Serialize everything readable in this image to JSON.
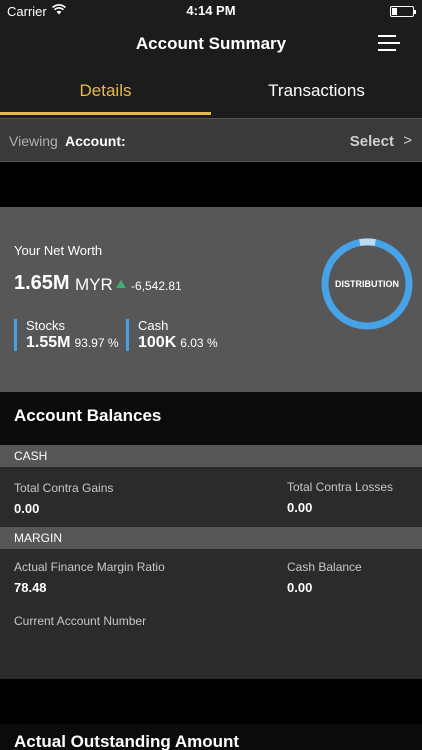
{
  "status_bar": {
    "carrier": "Carrier",
    "time": "4:14 PM"
  },
  "nav": {
    "title": "Account Summary",
    "menu_icon": "hamburger-menu-icon"
  },
  "tabs": [
    {
      "label": "Details",
      "active": true
    },
    {
      "label": "Transactions",
      "active": false
    }
  ],
  "viewing": {
    "label": "Viewing",
    "account_label": "Account:",
    "select_label": "Select",
    "chevron": ">"
  },
  "net_worth": {
    "label": "Your Net Worth",
    "value": "1.65M",
    "unit": "MYR",
    "change": "-6,542.81",
    "trend_icon": "up-arrow-icon",
    "distribution_label": "DISTRIBUTION",
    "stocks": {
      "name": "Stocks",
      "value": "1.55M",
      "percent": "93.97 %"
    },
    "cash": {
      "name": "Cash",
      "value": "100K",
      "percent": "6.03 %"
    }
  },
  "colors": {
    "accent": "#e6b94a",
    "donut_primary": "#46a3e8",
    "donut_secondary": "#bcdcf5",
    "trend_up": "#3cb371"
  },
  "account_balances": {
    "title": "Account Balances",
    "cash": {
      "header": "CASH",
      "fields": [
        {
          "label": "Total Contra Gains",
          "value": "0.00"
        },
        {
          "label": "Total Contra Losses",
          "value": "0.00"
        }
      ]
    },
    "margin": {
      "header": "MARGIN",
      "fields": [
        {
          "label": "Actual Finance Margin Ratio",
          "value": "78.48"
        },
        {
          "label": "Cash Balance",
          "value": "0.00"
        },
        {
          "label": "Current Account Number",
          "value": ""
        }
      ]
    }
  },
  "outstanding": {
    "title": "Actual Outstanding Amount"
  }
}
